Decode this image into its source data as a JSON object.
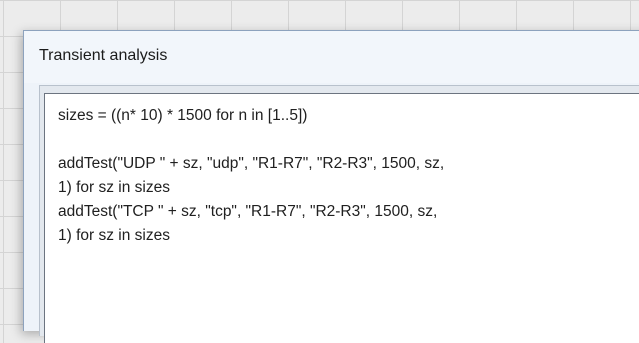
{
  "dialog": {
    "title": "Transient analysis"
  },
  "editor": {
    "lines": [
      "sizes = ((n* 10) * 1500 for n in [1..5])",
      "",
      "addTest(\"UDP \" + sz, \"udp\", \"R1-R7\", \"R2-R3\", 1500, sz,",
      "1) for sz in sizes",
      "addTest(\"TCP \" + sz, \"tcp\", \"R1-R7\", \"R2-R3\", 1500, sz,",
      "1) for sz in sizes"
    ]
  }
}
